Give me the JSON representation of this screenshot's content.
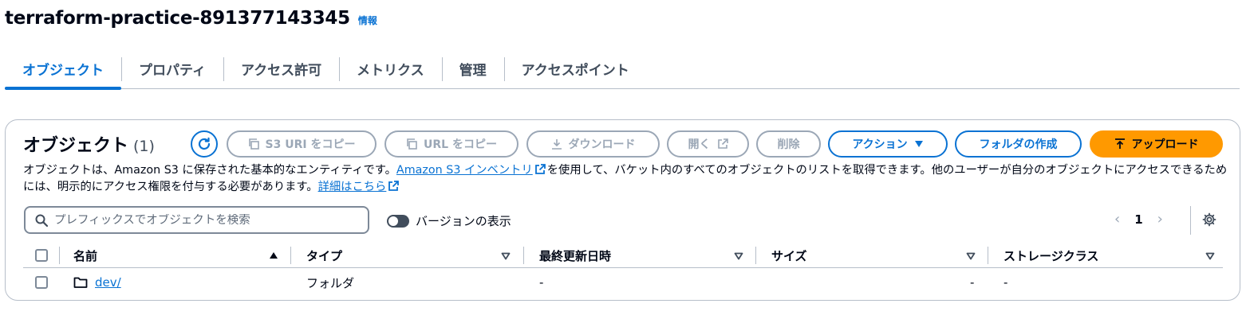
{
  "bucket": {
    "name": "terraform-practice-891377143345",
    "info": "情報"
  },
  "tabs": [
    {
      "label": "オブジェクト",
      "active": true
    },
    {
      "label": "プロパティ"
    },
    {
      "label": "アクセス許可"
    },
    {
      "label": "メトリクス"
    },
    {
      "label": "管理"
    },
    {
      "label": "アクセスポイント"
    }
  ],
  "panel": {
    "title": "オブジェクト",
    "count": "(1)",
    "buttons": {
      "copy_s3_uri": "S3 URI をコピー",
      "copy_url": "URL をコピー",
      "download": "ダウンロード",
      "open": "開く",
      "delete": "削除",
      "actions": "アクション",
      "create_folder": "フォルダの作成",
      "upload": "アップロード"
    },
    "description": {
      "part1": "オブジェクトは、Amazon S3 に保存された基本的なエンティティです。",
      "link1": "Amazon S3 インベントリ",
      "part2": "を使用して、バケット内のすべてのオブジェクトのリストを取得できます。他のユーザーが自分のオブジェクトにアクセスできるためには、明示的にアクセス権限を付与する必要があります。",
      "link2": "詳細はこちら"
    },
    "search_placeholder": "プレフィックスでオブジェクトを検索",
    "show_versions": "バージョンの表示",
    "page": "1"
  },
  "table": {
    "columns": {
      "name": "名前",
      "type": "タイプ",
      "modified": "最終更新日時",
      "size": "サイズ",
      "storage": "ストレージクラス"
    },
    "rows": [
      {
        "name": "dev/",
        "type": "フォルダ",
        "modified": "-",
        "size": "-",
        "storage": "-"
      }
    ]
  },
  "colors": {
    "accent": "#0972d3",
    "upload": "#ff9900",
    "disabled": "#9ba7b6"
  }
}
